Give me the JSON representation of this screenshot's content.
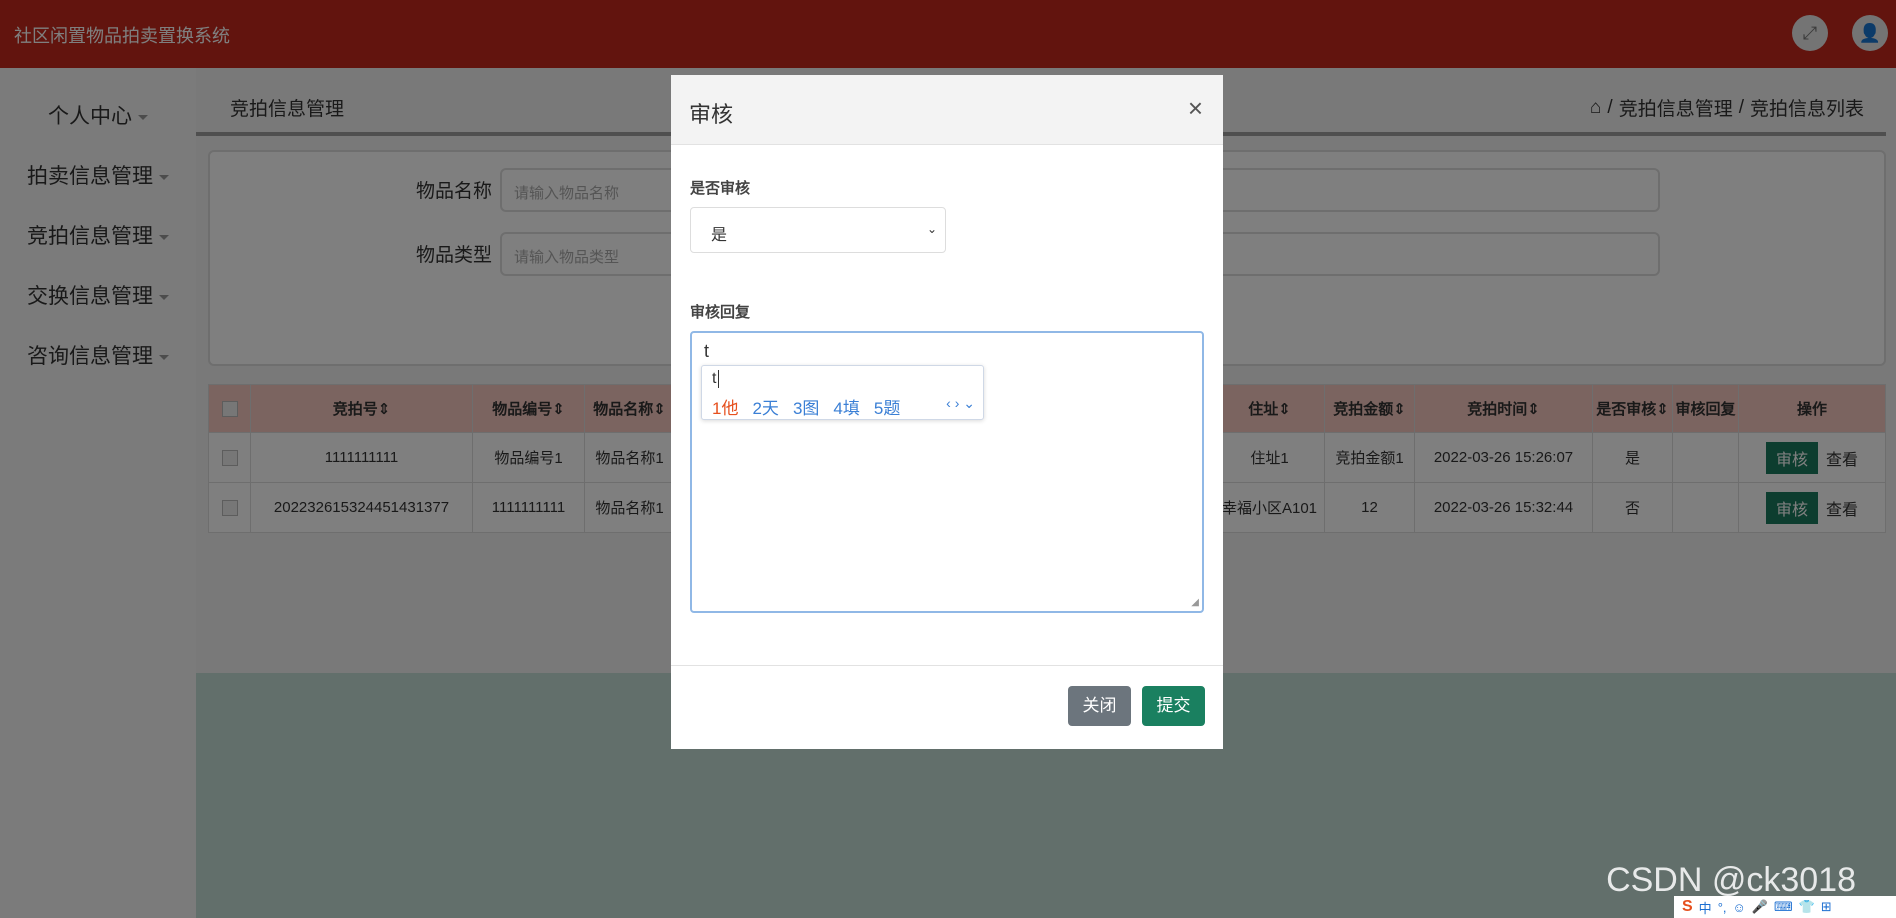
{
  "app_title": "社区闲置物品拍卖置换系统",
  "header_icons": [
    "fullscreen-icon",
    "user-icon"
  ],
  "sidebar": {
    "items": [
      {
        "label": "个人中心"
      },
      {
        "label": "拍卖信息管理"
      },
      {
        "label": "竞拍信息管理"
      },
      {
        "label": "交换信息管理"
      },
      {
        "label": "咨询信息管理"
      }
    ]
  },
  "page": {
    "heading": "竞拍信息管理",
    "breadcrumb": [
      "竞拍信息管理",
      "竞拍信息列表"
    ],
    "breadcrumb_sep": "/"
  },
  "search": {
    "name_label": "物品名称",
    "name_placeholder": "请输入物品名称",
    "type_label": "物品类型",
    "type_placeholder": "请输入物品类型"
  },
  "table": {
    "headers": [
      "竞拍号",
      "物品编号",
      "物品名称",
      "住址",
      "竞拍金额",
      "竞拍时间",
      "是否审核",
      "审核回复",
      "操作"
    ],
    "rows": [
      {
        "bid_no": "1111111111",
        "item_no": "物品编号1",
        "item_name": "物品名称1",
        "address": "住址1",
        "amount": "竞拍金额1",
        "time": "2022-03-26 15:26:07",
        "audited": "是",
        "reply": "",
        "audit_btn": "审核",
        "view_btn": "查看"
      },
      {
        "bid_no": "20223261532445143137​7",
        "item_no": "1111111111",
        "item_name": "物品名称1",
        "address": "幸福小区A101",
        "amount": "12",
        "time": "2022-03-26 15:32:44",
        "audited": "否",
        "reply": "",
        "audit_btn": "审核",
        "view_btn": "查看"
      }
    ]
  },
  "modal": {
    "title": "审核",
    "close_symbol": "×",
    "audit_label": "是否审核",
    "audit_value": "是",
    "reply_label": "审核回复",
    "reply_value": "t",
    "ime": {
      "typed": "t",
      "candidates": [
        "1他",
        "2天",
        "3图",
        "4填",
        "5题"
      ],
      "nav": "‹ › ⌄"
    },
    "close_button": "关闭",
    "submit_button": "提交"
  },
  "watermark": "CSDN @ck3018",
  "tray": {
    "ime_logo": "S",
    "ime_mode": "中"
  }
}
